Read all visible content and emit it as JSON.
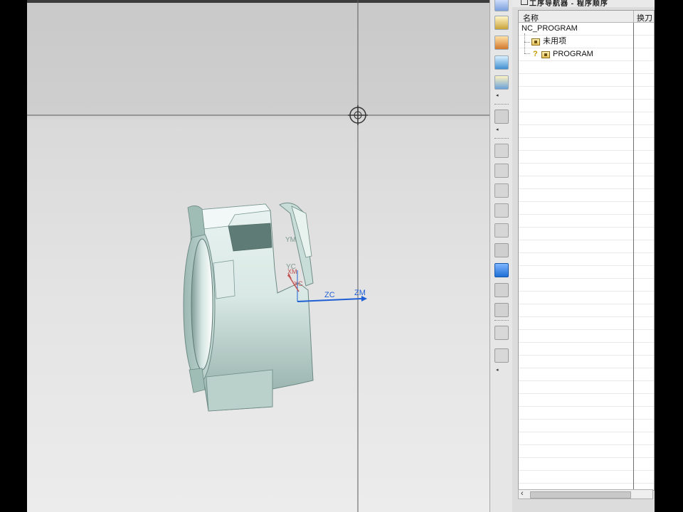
{
  "navigator": {
    "title": "工序导航器 - 程序顺序",
    "columns": {
      "name": "名称",
      "tool_change": "换刀"
    },
    "tree": [
      {
        "label": "NC_PROGRAM",
        "icon": "none"
      },
      {
        "label": "未用项",
        "icon": "folder-icon"
      },
      {
        "label": "PROGRAM",
        "icon": "folder-icon",
        "marker": "key-icon"
      }
    ]
  },
  "toolbar": {
    "icons": [
      "create-program-icon",
      "create-tool-icon",
      "create-geometry-icon",
      "create-method-icon",
      "create-operation-icon",
      "machine-tool-view-icon",
      "program-order-view-icon",
      "generate-toolpath-icon",
      "replay-toolpath-icon",
      "list-toolpath-icon",
      "verify-toolpath-icon",
      "simulate-machine-icon",
      "postprocess-icon",
      "shop-doc-icon",
      "output-cls-icon",
      "tool-icon",
      "holder-icon"
    ]
  },
  "viewport": {
    "axes": {
      "zc": "ZC",
      "zm": "ZM",
      "yc": "YC",
      "ym": "YM",
      "xc": "XC",
      "xm": "XM"
    },
    "part_color": "#cfe2de",
    "wcs_color": "#c05050",
    "mcs_color": "#1f5fd6"
  }
}
